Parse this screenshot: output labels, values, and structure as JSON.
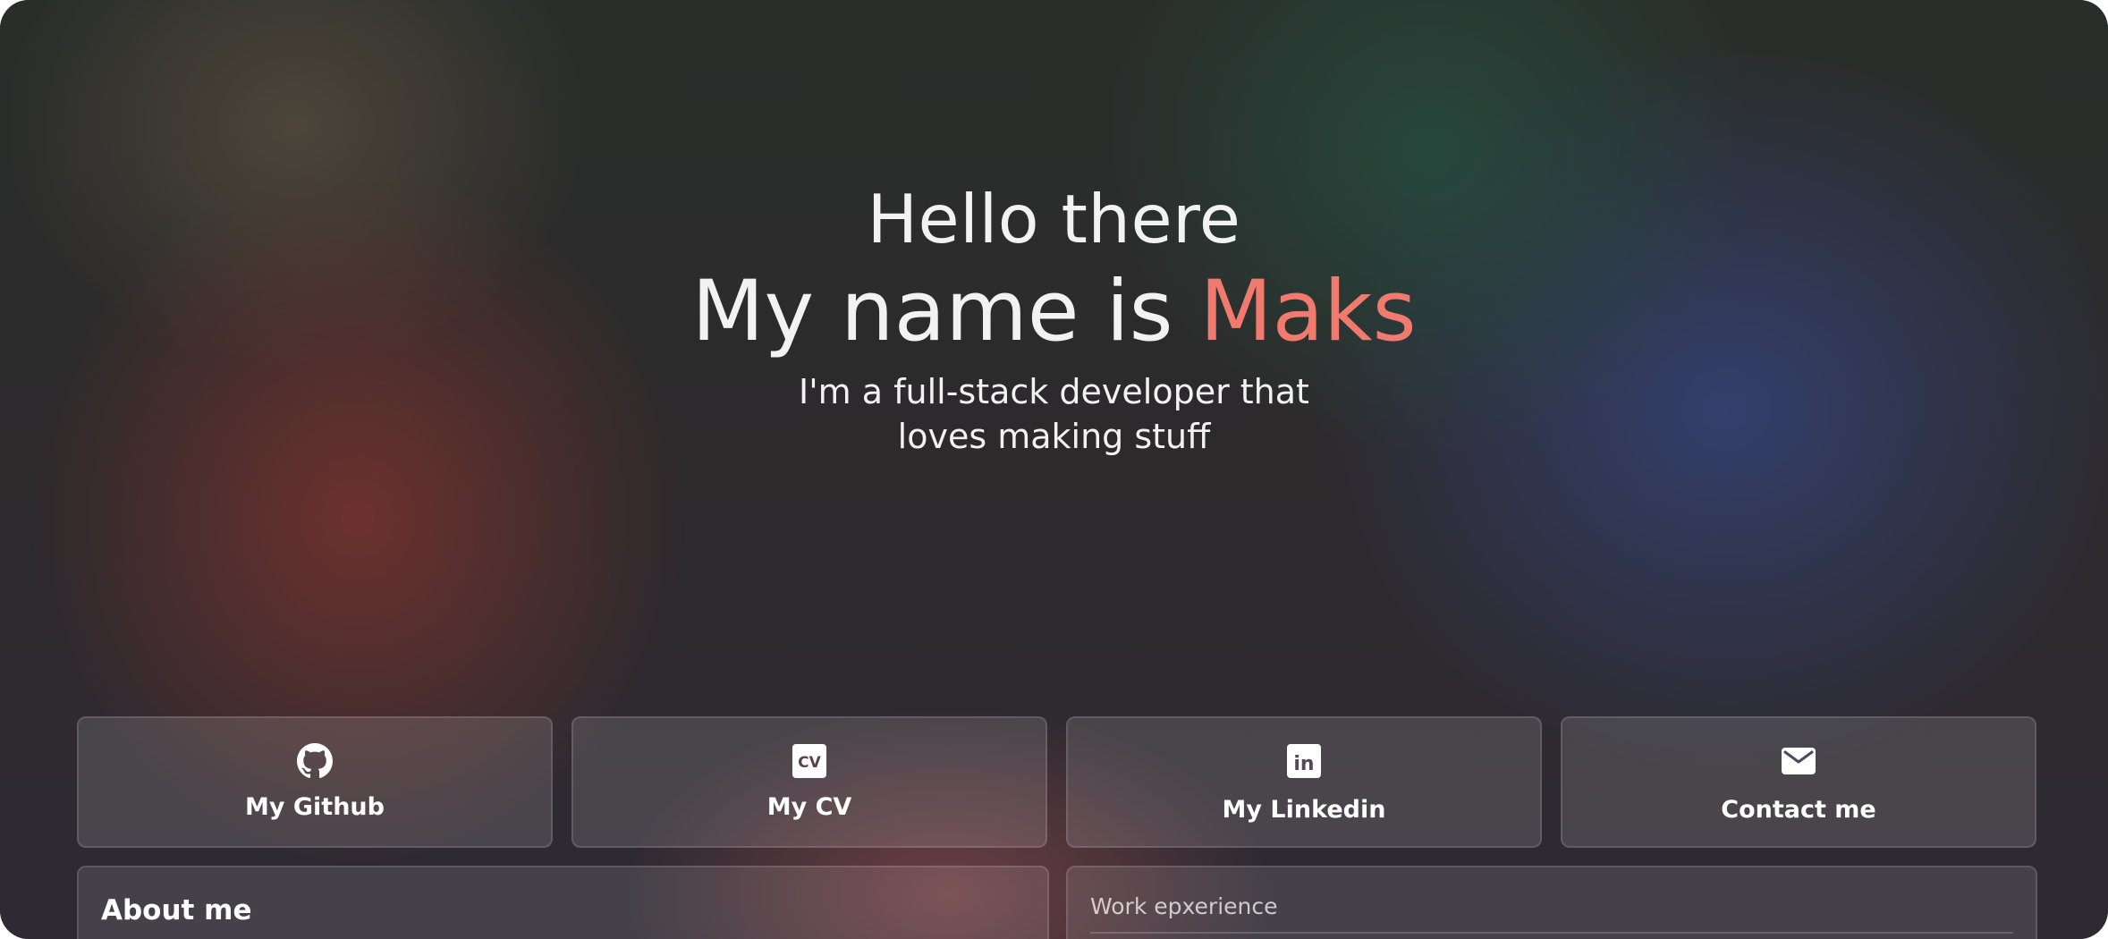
{
  "hero": {
    "greeting": "Hello there",
    "name_prefix": "My name is ",
    "name": "Maks",
    "subtitle_line1": "I'm a full-stack developer that",
    "subtitle_line2": "loves making stuff"
  },
  "links": [
    {
      "label": "My Github",
      "icon": "github-icon"
    },
    {
      "label": "My CV",
      "icon": "cv-icon",
      "icon_text": "CV"
    },
    {
      "label": "My Linkedin",
      "icon": "linkedin-icon",
      "icon_text": "in"
    },
    {
      "label": "Contact me",
      "icon": "mail-icon"
    }
  ],
  "sections": {
    "about_title": "About me",
    "work_title": "Work epxerience"
  },
  "colors": {
    "accent": "#f07a6d",
    "text": "#ffffff"
  }
}
